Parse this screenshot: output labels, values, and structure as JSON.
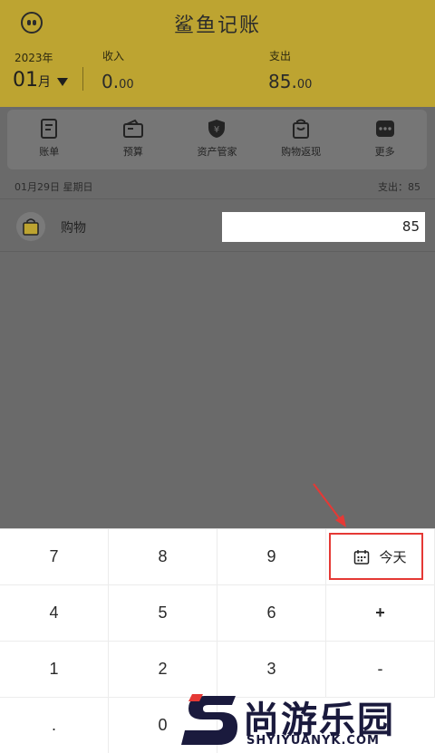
{
  "app": {
    "title": "鲨鱼记账"
  },
  "summary": {
    "year": "2023年",
    "month_number": "01",
    "month_suffix": "月",
    "income_label": "收入",
    "income_int": "0.",
    "income_dec": "00",
    "expense_label": "支出",
    "expense_int": "85.",
    "expense_dec": "00"
  },
  "nav": [
    {
      "label": "账单",
      "icon": "bill-icon"
    },
    {
      "label": "预算",
      "icon": "wallet-icon"
    },
    {
      "label": "资产管家",
      "icon": "shield-icon"
    },
    {
      "label": "购物返现",
      "icon": "shopping-bag-icon"
    },
    {
      "label": "更多",
      "icon": "more-icon"
    }
  ],
  "day": {
    "date": "01月29日 星期日",
    "expense": "支出：85"
  },
  "entry": {
    "category": "购物",
    "icon": "shopping-bag-icon",
    "amount": "85"
  },
  "keypad": {
    "r1": [
      "7",
      "8",
      "9"
    ],
    "today_label": "今天",
    "r2": [
      "4",
      "5",
      "6",
      "+"
    ],
    "r3": [
      "1",
      "2",
      "3",
      "-"
    ],
    "r4": [
      ".",
      "0"
    ]
  },
  "watermark": {
    "cn": "尚游乐园",
    "en": "SHYIYUANYK.COM"
  },
  "colors": {
    "header": "#bda431",
    "overlay": "#6a6a6a",
    "highlight": "#e53935"
  }
}
